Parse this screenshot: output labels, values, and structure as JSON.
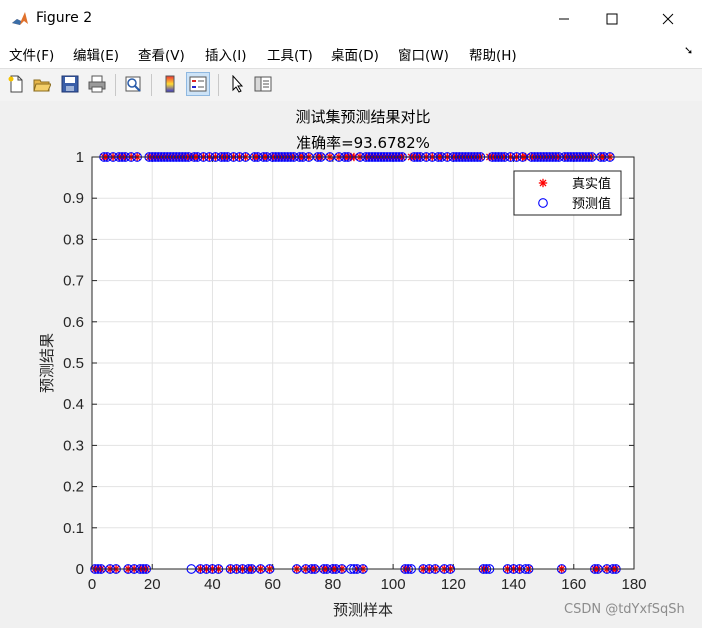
{
  "window": {
    "title": "Figure 2",
    "controls": {
      "minimize": "—",
      "maximize": "☐",
      "close": "✕"
    }
  },
  "menu": {
    "items": [
      "文件(F)",
      "编辑(E)",
      "查看(V)",
      "插入(I)",
      "工具(T)",
      "桌面(D)",
      "窗口(W)",
      "帮助(H)"
    ],
    "overflow_icon": "dock-arrow-icon"
  },
  "toolbar": {
    "buttons": [
      "new-figure-icon",
      "open-file-icon",
      "save-icon",
      "print-icon",
      "print-preview-icon",
      "colorbar-icon",
      "legend-icon",
      "pointer-icon",
      "property-editor-icon"
    ],
    "active": [
      "legend-icon"
    ]
  },
  "watermark": "CSDN @tdYxfSqSh",
  "chart_data": {
    "type": "scatter",
    "title": "测试集预测结果对比",
    "subtitle": "准确率=93.6782%",
    "xlabel": "预测样本",
    "ylabel": "预测结果",
    "xlim": [
      0,
      180
    ],
    "ylim": [
      0,
      1
    ],
    "xticks": [
      0,
      20,
      40,
      60,
      80,
      100,
      120,
      140,
      160,
      180
    ],
    "yticks": [
      "0",
      "0.1",
      "0.2",
      "0.3",
      "0.4",
      "0.5",
      "0.6",
      "0.7",
      "0.8",
      "0.9",
      "1"
    ],
    "grid": true,
    "legend_position": "top-right",
    "n_samples": 174,
    "series": [
      {
        "name": "真实值",
        "marker": "asterisk",
        "color": "#ff0000",
        "values": [
          0,
          0,
          0,
          1,
          1,
          0,
          1,
          0,
          1,
          1,
          1,
          0,
          1,
          0,
          1,
          0,
          0,
          0,
          1,
          1,
          1,
          1,
          1,
          1,
          1,
          1,
          1,
          1,
          1,
          1,
          1,
          1,
          1,
          1,
          1,
          0,
          1,
          0,
          1,
          0,
          1,
          0,
          1,
          1,
          1,
          0,
          1,
          0,
          1,
          0,
          1,
          0,
          0,
          1,
          1,
          0,
          1,
          1,
          0,
          1,
          1,
          1,
          1,
          1,
          1,
          1,
          1,
          0,
          1,
          1,
          0,
          1,
          0,
          0,
          1,
          1,
          0,
          0,
          1,
          0,
          0,
          1,
          0,
          1,
          1,
          1,
          1,
          0,
          1,
          0,
          1,
          1,
          1,
          1,
          1,
          1,
          1,
          1,
          1,
          1,
          1,
          1,
          1,
          0,
          0,
          1,
          1,
          1,
          1,
          0,
          1,
          0,
          1,
          0,
          1,
          1,
          0,
          1,
          0,
          1,
          1,
          1,
          1,
          1,
          1,
          1,
          1,
          1,
          1,
          0,
          0,
          1,
          1,
          1,
          1,
          1,
          1,
          0,
          1,
          0,
          1,
          0,
          1,
          1,
          0,
          1,
          1,
          1,
          1,
          1,
          1,
          1,
          1,
          1,
          1,
          0,
          1,
          1,
          1,
          1,
          1,
          1,
          1,
          1,
          1,
          1,
          0,
          0,
          1,
          1,
          0,
          1,
          0,
          0
        ]
      },
      {
        "name": "预测值",
        "marker": "circle",
        "color": "#0000ff",
        "values": [
          0,
          0,
          0,
          1,
          1,
          0,
          1,
          0,
          1,
          1,
          1,
          0,
          1,
          0,
          1,
          0,
          0,
          0,
          1,
          1,
          1,
          1,
          1,
          1,
          1,
          1,
          1,
          1,
          1,
          1,
          1,
          1,
          0,
          1,
          1,
          0,
          1,
          0,
          1,
          0,
          1,
          0,
          1,
          1,
          1,
          0,
          1,
          0,
          1,
          0,
          1,
          0,
          0,
          1,
          1,
          0,
          1,
          1,
          0,
          1,
          1,
          1,
          1,
          1,
          1,
          1,
          1,
          0,
          1,
          1,
          0,
          1,
          0,
          0,
          1,
          1,
          0,
          0,
          1,
          0,
          0,
          1,
          0,
          1,
          1,
          0,
          0,
          0,
          1,
          0,
          1,
          1,
          1,
          1,
          1,
          1,
          1,
          1,
          1,
          1,
          1,
          1,
          1,
          0,
          0,
          0,
          1,
          1,
          1,
          0,
          1,
          0,
          1,
          0,
          1,
          1,
          0,
          1,
          0,
          1,
          1,
          1,
          1,
          1,
          1,
          1,
          1,
          1,
          1,
          0,
          0,
          0,
          1,
          1,
          1,
          1,
          1,
          0,
          1,
          0,
          1,
          0,
          1,
          0,
          0,
          1,
          1,
          1,
          1,
          1,
          1,
          1,
          1,
          1,
          1,
          0,
          1,
          1,
          1,
          1,
          1,
          1,
          1,
          1,
          1,
          1,
          0,
          0,
          1,
          1,
          0,
          1,
          0,
          0
        ]
      }
    ]
  }
}
